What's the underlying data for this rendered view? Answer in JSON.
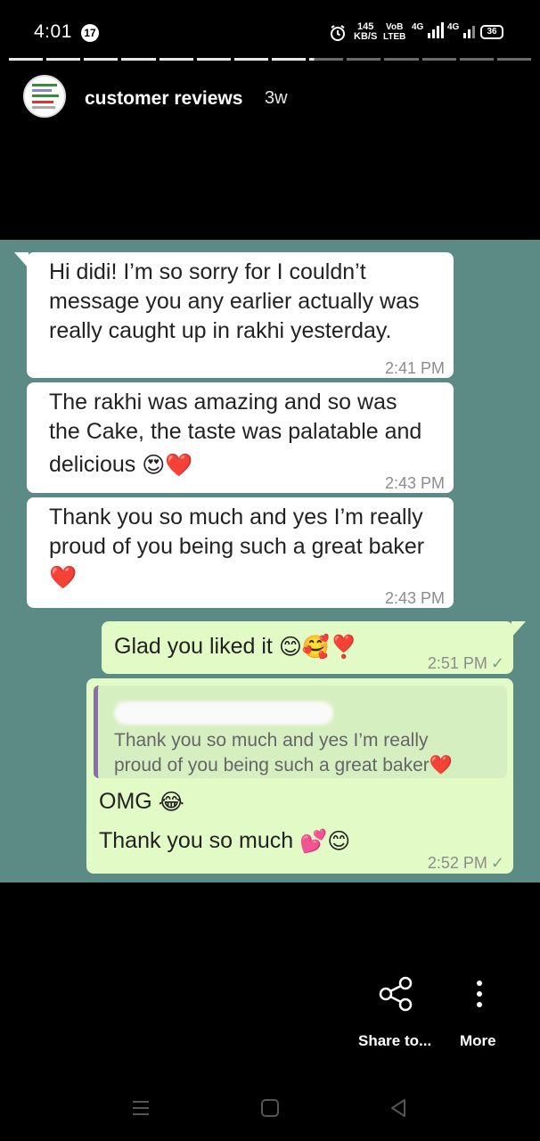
{
  "status_bar": {
    "time": "4:01",
    "notification_count": "17",
    "net_speed_value": "145",
    "net_speed_unit": "KB/S",
    "volte_top": "VoB",
    "volte_bottom": "LTEB",
    "network_1": "4G",
    "network_2": "4G",
    "battery": "36",
    "icons": [
      "alarm-icon",
      "signal-icon",
      "signal-icon",
      "battery-icon"
    ]
  },
  "story": {
    "segments": 14,
    "segments_completed": 8,
    "account_name": "customer reviews",
    "posted_ago": "3w"
  },
  "chat": {
    "background_color": "#5c8a85",
    "incoming_color": "#ffffff",
    "outgoing_color": "#e2fbc6",
    "messages": [
      {
        "direction": "incoming",
        "lines": [
          "Hi didi! I’m so sorry for I couldn’t",
          "message you any earlier actually was",
          "really caught up in rakhi yesterday."
        ],
        "emoji": "",
        "time": "2:41 PM"
      },
      {
        "direction": "incoming",
        "lines": [
          "The rakhi was amazing and so was",
          "the Cake, the taste was palatable and",
          "delicious"
        ],
        "emoji": "😍❤️",
        "time": "2:43 PM"
      },
      {
        "direction": "incoming",
        "lines": [
          "Thank you so much and yes I’m really",
          "proud of you being such a great baker"
        ],
        "emoji": "❤️",
        "time": "2:43 PM"
      },
      {
        "direction": "outgoing",
        "text": "Glad you liked it",
        "emoji": "😊🥰❣️",
        "time": "2:51 PM",
        "status": "✓"
      },
      {
        "direction": "outgoing",
        "quote_lines": [
          "Thank you so much and yes I’m really",
          "proud of you being such a great baker❤️"
        ],
        "line1": "OMG",
        "line1_emoji": "😂",
        "line2": "Thank you so much",
        "line2_emoji": "💕😊",
        "time": "2:52 PM",
        "status": "✓"
      }
    ]
  },
  "actions": {
    "share_label": "Share to...",
    "more_label": "More",
    "share_icon": "share-icon",
    "more_icon": "more-vertical-icon"
  },
  "nav_bar": {
    "icons": [
      "recents-icon",
      "home-icon",
      "back-icon"
    ]
  }
}
